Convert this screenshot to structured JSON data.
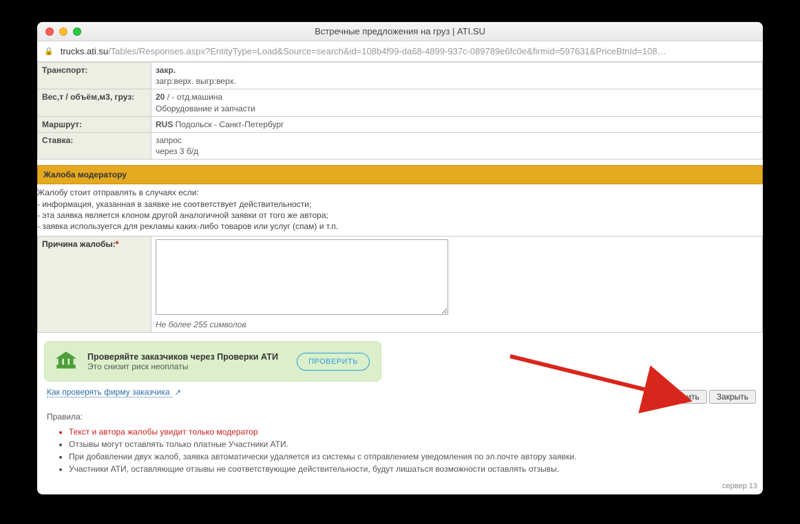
{
  "window": {
    "title": "Встречные предложения на груз | ATI.SU",
    "host": "trucks.ati.su",
    "path": "/Tables/Responses.aspx?EntityType=Load&Source=search&id=108b4f99-da68-4899-937c-089789e6fc0e&firmid=597631&PriceBtnId=108…"
  },
  "info": {
    "transport_label": "Транспорт:",
    "transport_bold": "закр.",
    "transport_line2": "загр:верх. выгр:верх.",
    "weight_label": "Вес,т / объём,м3, груз:",
    "weight_bold": "20",
    "weight_rest": " / - отд.машина",
    "weight_line2": "Оборудование и запчасти",
    "route_label": "Маршрут:",
    "route_bold": "RUS",
    "route_rest": " Подольск - Санкт-Петербург",
    "rate_label": "Ставка:",
    "rate_line1": "запрос",
    "rate_line2": "через 3 б/д"
  },
  "complaint": {
    "header": "Жалоба модератору",
    "note_intro": "Жалобу стоит отправлять в случаях если:",
    "note1": "- информация, указанная в заявке не соответствует действительности;",
    "note2": "- эта заявка является клоном другой аналогичной заявки от того же автора;",
    "note3": "- заявка используется для рекламы каких-либо товаров или услуг (спам) и т.п.",
    "reason_label": "Причина жалобы:",
    "reason_hint": "Не более 255 символов"
  },
  "promo": {
    "title": "Проверяйте заказчиков через Проверки АТИ",
    "sub": "Это снизит риск неоплаты",
    "button": "ПРОВЕРИТЬ"
  },
  "howcheck_link": "Как проверять фирму заказчика ",
  "buttons": {
    "save": "Сохранить",
    "close": "Закрыть"
  },
  "rules": {
    "title": "Правила:",
    "r1": "Текст и автора жалобы увидит только модератор",
    "r2": "Отзывы могут оставлять только платные Участники АТИ.",
    "r3": "При добавлении двух жалоб, заявка автоматически удаляется из системы с отправлением уведомления по эл.почте автору заявки.",
    "r4": "Участники АТИ, оставляющие отзывы не соответствующие действительности, будут лишаться возможности оставлять отзывы."
  },
  "server": "сервер 13"
}
